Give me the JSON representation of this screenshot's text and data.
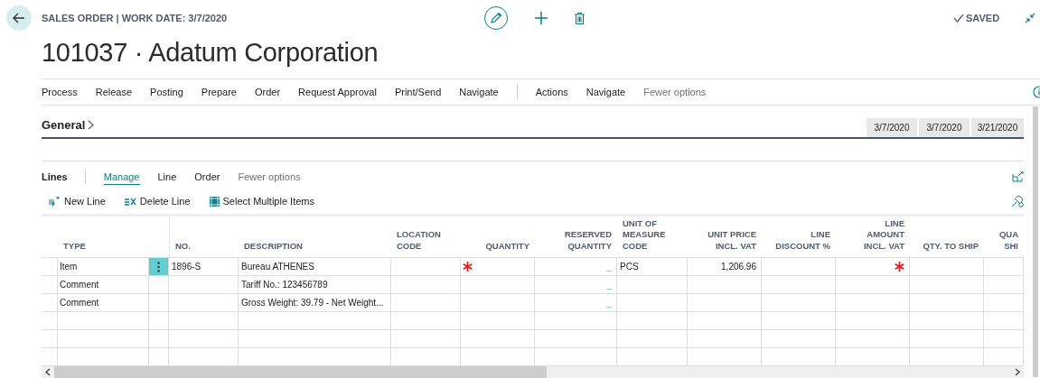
{
  "header": {
    "caption": "SALES ORDER | WORK DATE: 3/7/2020",
    "title": "101037 · Adatum Corporation",
    "status": "SAVED"
  },
  "actions": [
    {
      "label": "Process",
      "kind": "menu"
    },
    {
      "label": "Release",
      "kind": "menu"
    },
    {
      "label": "Posting",
      "kind": "menu"
    },
    {
      "label": "Prepare",
      "kind": "menu"
    },
    {
      "label": "Order",
      "kind": "menu"
    },
    {
      "label": "Request Approval",
      "kind": "menu"
    },
    {
      "label": "Print/Send",
      "kind": "menu"
    },
    {
      "label": "Navigate",
      "kind": "menu"
    },
    {
      "label": "Actions",
      "kind": "menu",
      "separator_before": true
    },
    {
      "label": "Navigate",
      "kind": "menu"
    },
    {
      "label": "Fewer options",
      "kind": "toggle"
    }
  ],
  "general": {
    "title": "General",
    "dates": [
      "3/7/2020",
      "3/7/2020",
      "3/21/2020"
    ]
  },
  "lines": {
    "title": "Lines",
    "tabs": [
      {
        "label": "Manage",
        "selected": true,
        "kind": "menu"
      },
      {
        "label": "Line",
        "selected": false,
        "kind": "menu"
      },
      {
        "label": "Order",
        "selected": false,
        "kind": "menu"
      },
      {
        "label": "Fewer options",
        "selected": false,
        "kind": "toggle"
      }
    ],
    "toolbar": [
      {
        "label": "New Line",
        "kind": "new"
      },
      {
        "label": "Delete Line",
        "kind": "delete"
      },
      {
        "label": "Select Multiple Items",
        "kind": "select"
      }
    ],
    "columns": [
      "TYPE",
      "NO.",
      "DESCRIPTION",
      "LOCATION\nCODE",
      "QUANTITY",
      "RESERVED\nQUANTITY",
      "UNIT OF\nMEASURE\nCODE",
      "UNIT PRICE\nINCL. VAT",
      "LINE\nDISCOUNT %",
      "LINE\nAMOUNT\nINCL. VAT",
      "QTY. TO SHIP",
      "QUA\nSHI"
    ],
    "rows": [
      {
        "selected": true,
        "type": "Item",
        "no": "1896-S",
        "description": "Bureau ATHENES",
        "quantity_required": true,
        "reserved_quantity": "_",
        "uom": "PCS",
        "unit_price": "1,206.96",
        "line_amount_required": true
      },
      {
        "selected": false,
        "type": "Comment",
        "description": "Tariff No.: 123456789",
        "reserved_quantity": "_"
      },
      {
        "selected": false,
        "type": "Comment",
        "description": "Gross Weight: 39.79 - Net Weight...",
        "reserved_quantity": "_"
      },
      {
        "selected": false
      },
      {
        "selected": false
      },
      {
        "selected": false
      }
    ]
  }
}
